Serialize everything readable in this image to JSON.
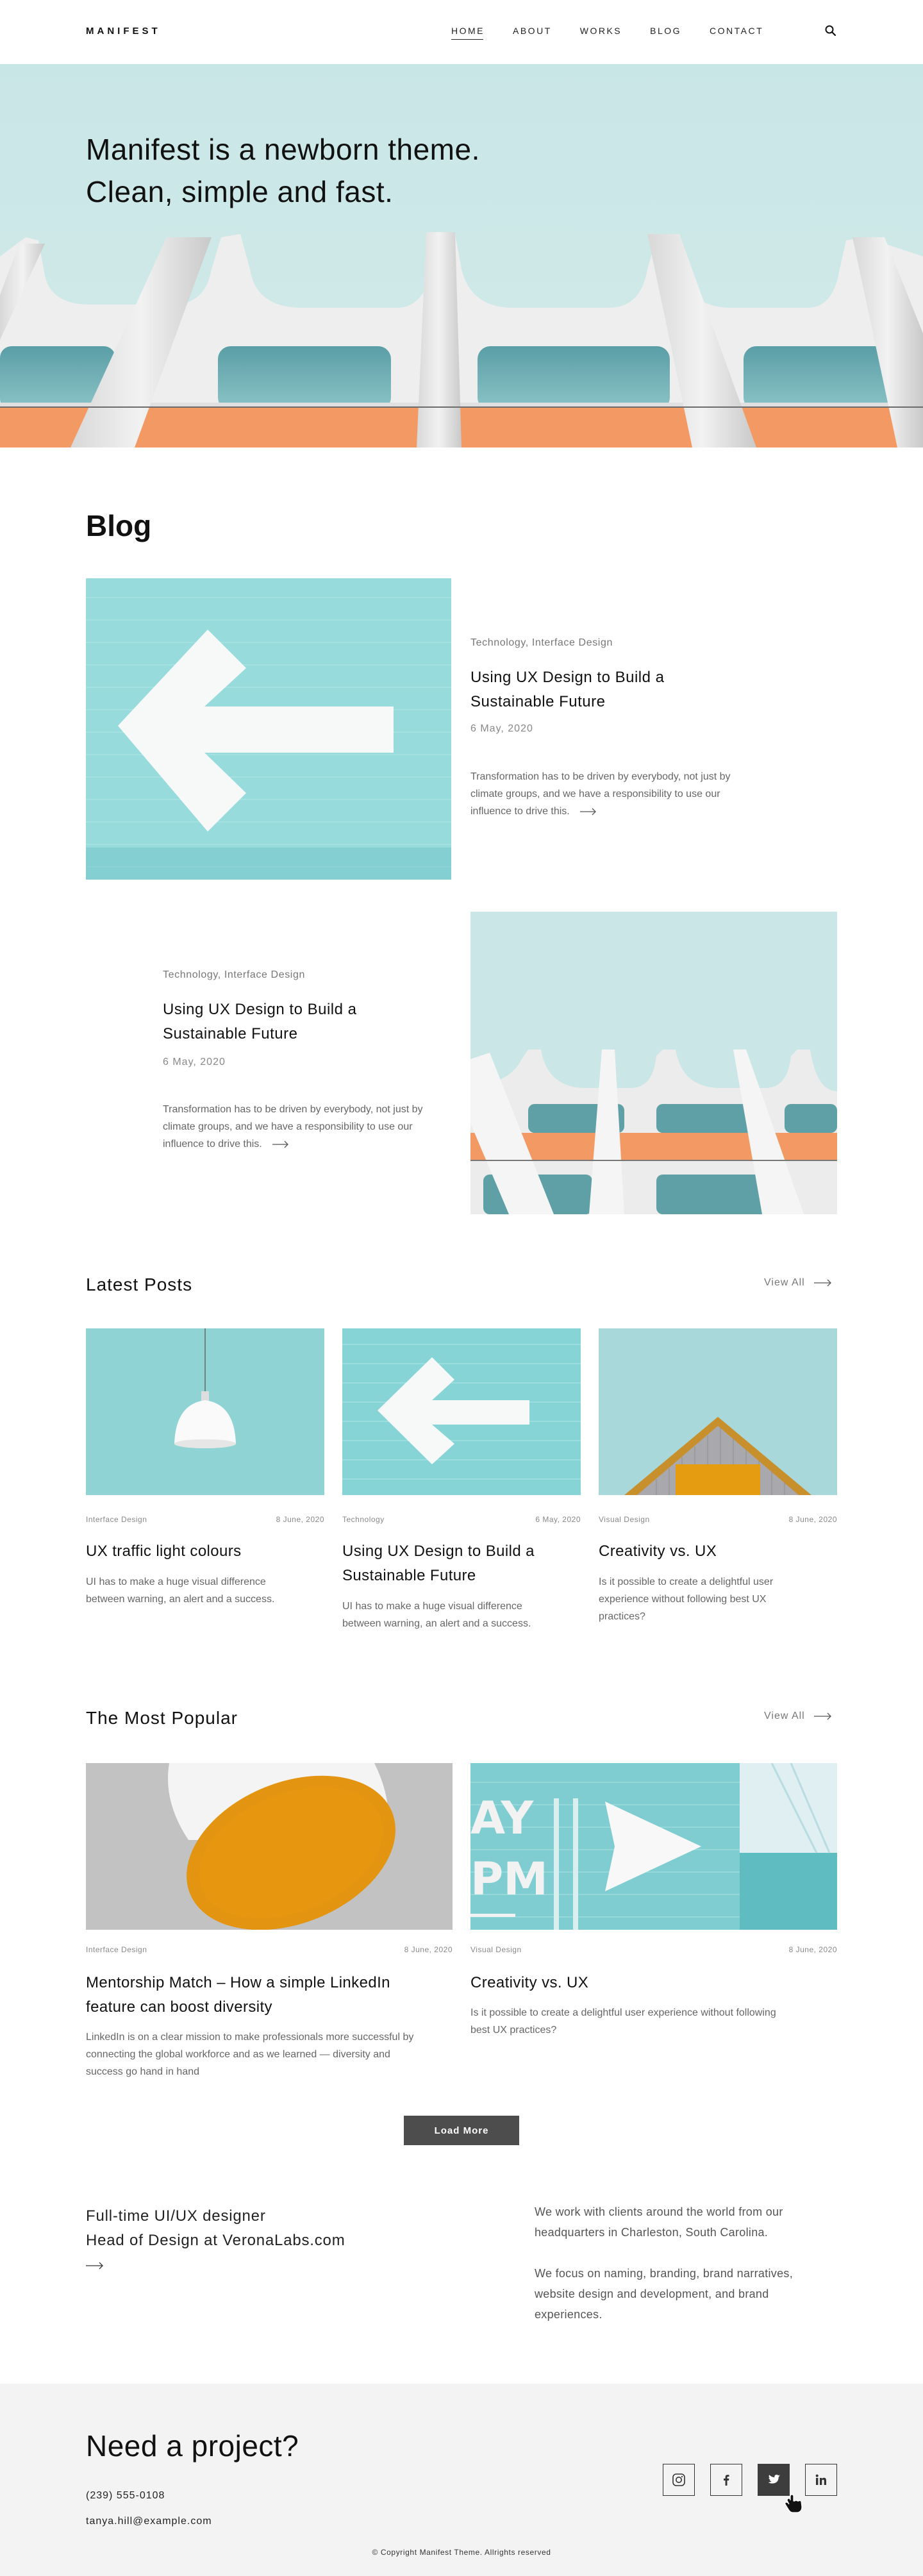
{
  "header": {
    "logo": "MANIFEST",
    "nav": [
      "HOME",
      "ABOUT",
      "WORKS",
      "BLOG",
      "CONTACT"
    ],
    "active_nav": "HOME",
    "search_icon": "search-icon"
  },
  "hero": {
    "title_line1": "Manifest is a newborn theme.",
    "title_line2": "Clean, simple and fast."
  },
  "blog": {
    "title": "Blog",
    "featured": [
      {
        "meta": "Technology, Interface Design",
        "title_line1": "Using UX Design to Build a",
        "title_line2": "Sustainable Future",
        "date": "6 May, 2020",
        "excerpt_line1": "Transformation has to be driven by everybody, not just by",
        "excerpt_line2": "climate groups, and we have a responsibility to use our",
        "excerpt_line3": "influence to drive this."
      },
      {
        "meta": "Technology, Interface Design",
        "title_line1": "Using UX Design to Build a",
        "title_line2": "Sustainable Future",
        "date": "6 May, 2020",
        "excerpt_line1": "Transformation has to be driven by everybody, not just by",
        "excerpt_line2": "climate groups, and we have a responsibility to use our",
        "excerpt_line3": "influence to drive this."
      }
    ]
  },
  "latest": {
    "title": "Latest Posts",
    "view_all": "View All",
    "cards": [
      {
        "category": "Interface Design",
        "date": "8 June, 2020",
        "title_line1": "UX traffic light colours",
        "title_line2": "",
        "excerpt_line1": "UI has to make a huge visual difference",
        "excerpt_line2": "between warning, an alert and a success.",
        "excerpt_line3": ""
      },
      {
        "category": "Technology",
        "date": "6 May, 2020",
        "title_line1": "Using UX Design to Build a",
        "title_line2": "Sustainable Future",
        "excerpt_line1": "UI has to make a huge visual difference",
        "excerpt_line2": "between warning, an alert and a success.",
        "excerpt_line3": ""
      },
      {
        "category": "Visual Design",
        "date": "8 June, 2020",
        "title_line1": "Creativity vs. UX",
        "title_line2": "",
        "excerpt_line1": "Is it possible to create a delightful user",
        "excerpt_line2": "experience without following best UX",
        "excerpt_line3": "practices?"
      }
    ]
  },
  "popular": {
    "title": "The Most Popular",
    "view_all": "View All",
    "cards": [
      {
        "category": "Interface Design",
        "date": "8 June, 2020",
        "title_line1": "Mentorship Match – How a simple LinkedIn",
        "title_line2": "feature can boost diversity",
        "excerpt_line1": "LinkedIn is on a clear mission to make professionals more successful by",
        "excerpt_line2": "connecting the global workforce and as we learned — diversity and",
        "excerpt_line3": "success go hand in hand"
      },
      {
        "category": "Visual Design",
        "date": "8 June, 2020",
        "title_line1": "Creativity vs. UX",
        "title_line2": "",
        "excerpt_line1": "Is it possible to create a delightful user experience without following",
        "excerpt_line2": "best UX practices?",
        "excerpt_line3": ""
      }
    ],
    "load_more": "Load More"
  },
  "about": {
    "left_line1": "Full-time UI/UX designer",
    "left_line2": "Head of Design at VeronaLabs.com",
    "right_p1_line1": "We work with clients around the world from our",
    "right_p1_line2": "headquarters in Charleston, South Carolina.",
    "right_p2_line1": "We focus on naming, branding, brand narratives,",
    "right_p2_line2": "website design and development, and brand",
    "right_p2_line3": "experiences."
  },
  "footer": {
    "title": "Need a project?",
    "phone": "(239) 555-0108",
    "email": "tanya.hill@example.com",
    "social": [
      "instagram-icon",
      "facebook-icon",
      "twitter-icon",
      "linkedin-icon"
    ],
    "active_social": "twitter-icon",
    "copyright": "© Copyright Manifest Theme. Allrights reserved"
  },
  "colors": {
    "sky": "#cfe7e7",
    "teal_wall": "#7fd0d3",
    "orange": "#f39a64",
    "button_dark": "#4d4d4d",
    "footer_bg": "#f3f3f3"
  }
}
